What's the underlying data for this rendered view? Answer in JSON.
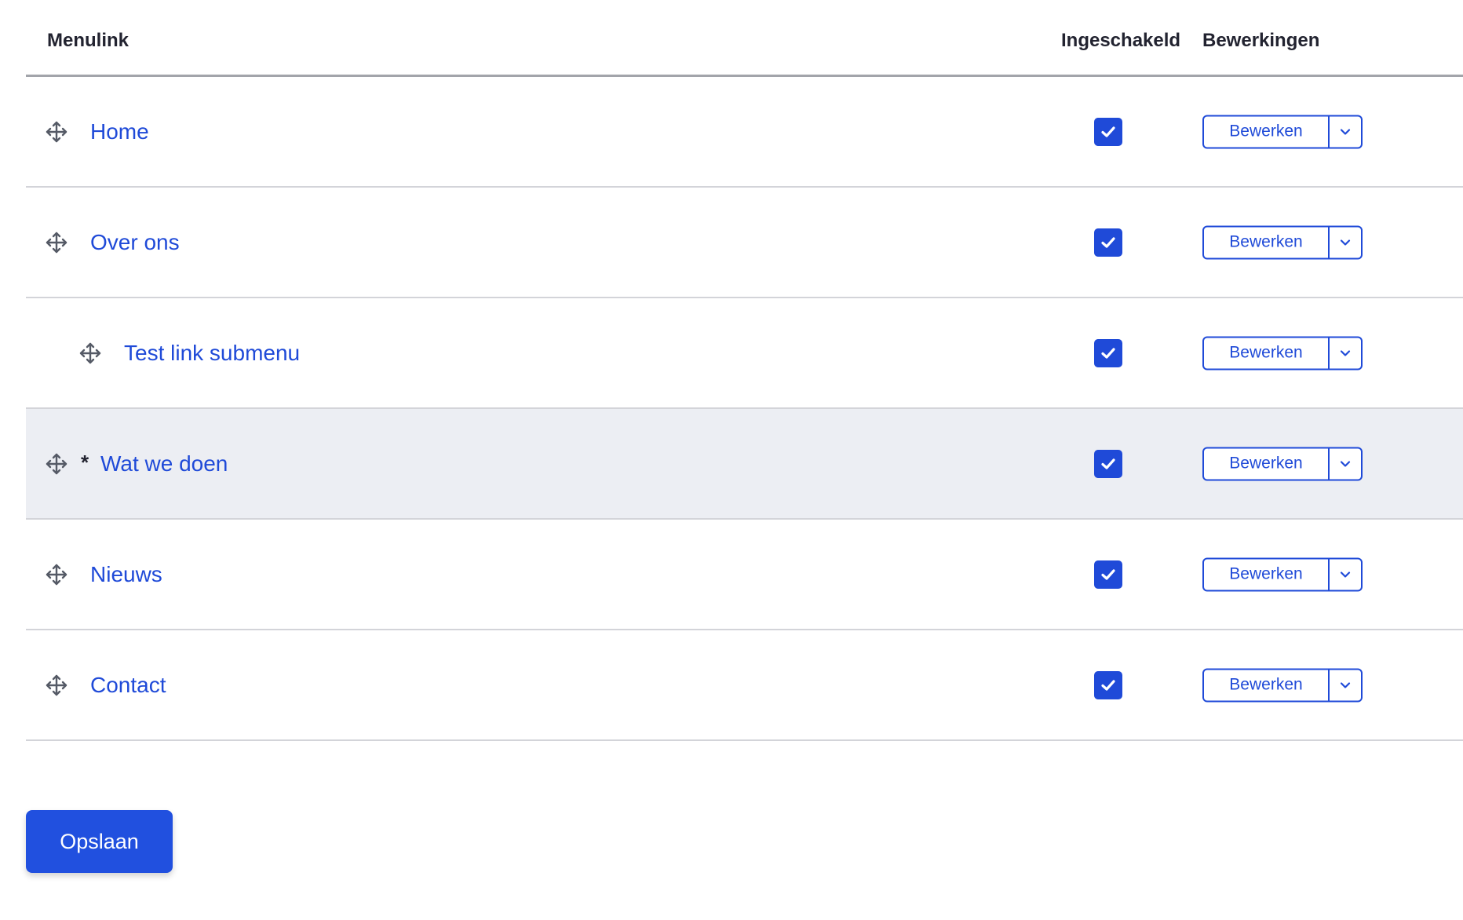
{
  "table": {
    "headers": {
      "menulink": "Menulink",
      "enabled": "Ingeschakeld",
      "operations": "Bewerkingen"
    },
    "rows": [
      {
        "label": "Home",
        "indent": 0,
        "changed": false,
        "highlighted": false,
        "enabled": true,
        "edit_label": "Bewerken"
      },
      {
        "label": "Over ons",
        "indent": 0,
        "changed": false,
        "highlighted": false,
        "enabled": true,
        "edit_label": "Bewerken"
      },
      {
        "label": "Test link submenu",
        "indent": 1,
        "changed": false,
        "highlighted": false,
        "enabled": true,
        "edit_label": "Bewerken"
      },
      {
        "label": "Wat we doen",
        "indent": 0,
        "changed": true,
        "changed_marker": "*",
        "highlighted": true,
        "enabled": true,
        "edit_label": "Bewerken"
      },
      {
        "label": "Nieuws",
        "indent": 0,
        "changed": false,
        "highlighted": false,
        "enabled": true,
        "edit_label": "Bewerken"
      },
      {
        "label": "Contact",
        "indent": 0,
        "changed": false,
        "highlighted": false,
        "enabled": true,
        "edit_label": "Bewerken"
      }
    ]
  },
  "actions": {
    "save_label": "Opslaan"
  },
  "colors": {
    "accent": "#1f4ad8",
    "highlight_row": "#eceef3",
    "header_border": "#a2a4aa",
    "row_border": "#d3d4d9"
  },
  "icons": {
    "drag": "move-arrows-icon",
    "checkbox": "checkmark-icon",
    "dropdown": "chevron-down-icon"
  }
}
